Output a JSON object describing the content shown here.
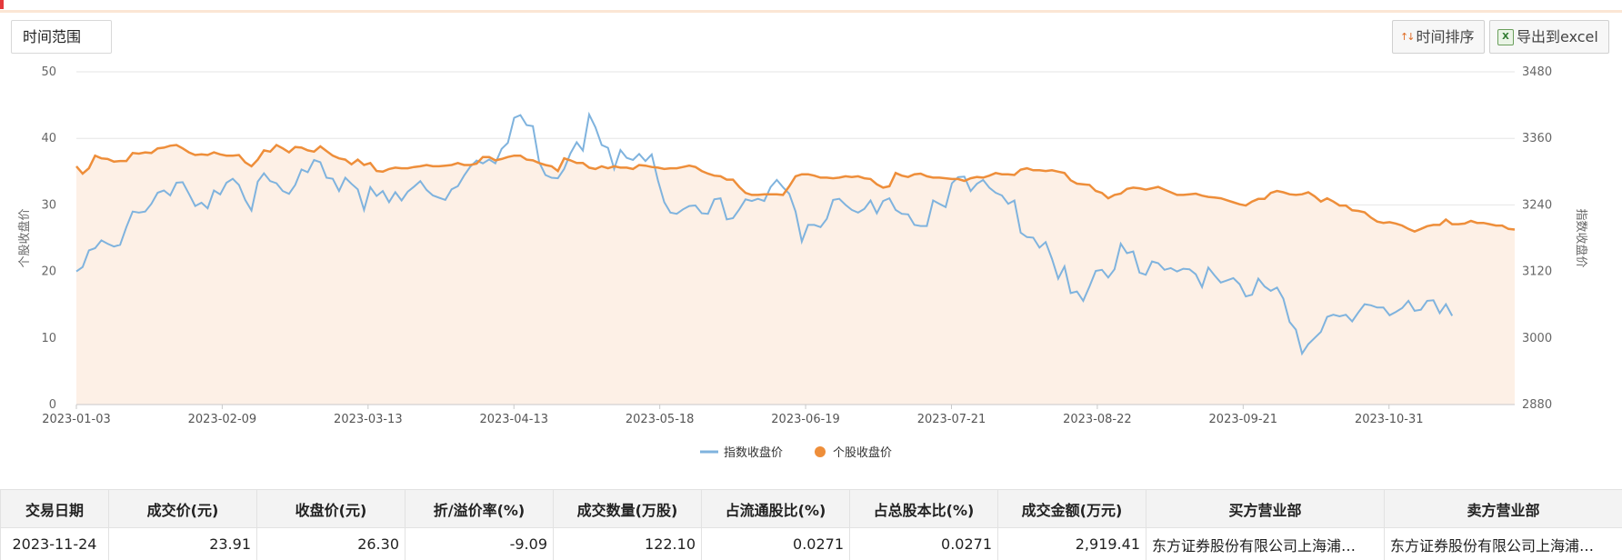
{
  "toolbar": {
    "time_range_label": "时间范围",
    "sort_label": "时间排序",
    "export_label": "导出到excel"
  },
  "colors": {
    "index_line": "#7fb3de",
    "stock_line": "#ee8e3a",
    "stock_area": "#fdf0e6",
    "accent": "#e4393c"
  },
  "chart_data": {
    "type": "line",
    "left_axis": {
      "label": "个股收盘价",
      "min": 0,
      "max": 50,
      "ticks": [
        "0",
        "10",
        "20",
        "30",
        "40",
        "50"
      ]
    },
    "right_axis": {
      "label": "指数收盘价",
      "min": 2880,
      "max": 3480,
      "ticks": [
        "2880",
        "3000",
        "3120",
        "3240",
        "3360",
        "3480"
      ]
    },
    "x_tick_labels": [
      "2023-01-03",
      "2023-02-09",
      "2023-03-13",
      "2023-04-13",
      "2023-05-18",
      "2023-06-19",
      "2023-07-21",
      "2023-08-22",
      "2023-09-21",
      "2023-10-31"
    ],
    "x_start": "2023-01-03",
    "x_end": "2023-11-24",
    "grid": true,
    "legend_position": "bottom",
    "series": [
      {
        "name": "指数收盘价",
        "axis": "right",
        "values": [
          3120,
          3128,
          3158,
          3162,
          3176,
          3170,
          3165,
          3168,
          3200,
          3228,
          3226,
          3228,
          3242,
          3262,
          3266,
          3257,
          3280,
          3281,
          3260,
          3238,
          3244,
          3234,
          3266,
          3259,
          3280,
          3287,
          3276,
          3249,
          3230,
          3282,
          3297,
          3283,
          3279,
          3265,
          3260,
          3276,
          3304,
          3299,
          3321,
          3317,
          3289,
          3287,
          3265,
          3289,
          3278,
          3268,
          3231,
          3272,
          3256,
          3265,
          3245,
          3263,
          3248,
          3264,
          3273,
          3283,
          3267,
          3257,
          3253,
          3249,
          3268,
          3274,
          3293,
          3309,
          3320,
          3315,
          3322,
          3315,
          3341,
          3352,
          3397,
          3402,
          3384,
          3382,
          3317,
          3294,
          3289,
          3288,
          3305,
          3333,
          3353,
          3338,
          3403,
          3380,
          3348,
          3343,
          3305,
          3339,
          3325,
          3321,
          3332,
          3319,
          3331,
          3284,
          3245,
          3226,
          3224,
          3232,
          3238,
          3239,
          3225,
          3224,
          3250,
          3252,
          3214,
          3216,
          3232,
          3250,
          3247,
          3251,
          3247,
          3272,
          3285,
          3272,
          3260,
          3228,
          3174,
          3204,
          3204,
          3200,
          3215,
          3249,
          3251,
          3240,
          3231,
          3226,
          3233,
          3248,
          3225,
          3247,
          3252,
          3231,
          3224,
          3223,
          3204,
          3202,
          3202,
          3248,
          3242,
          3236,
          3279,
          3290,
          3291,
          3265,
          3278,
          3285,
          3271,
          3262,
          3257,
          3242,
          3248,
          3190,
          3182,
          3181,
          3163,
          3173,
          3143,
          3107,
          3129,
          3081,
          3084,
          3067,
          3093,
          3121,
          3123,
          3109,
          3124,
          3170,
          3153,
          3156,
          3118,
          3114,
          3138,
          3135,
          3123,
          3126,
          3120,
          3125,
          3124,
          3115,
          3092,
          3127,
          3113,
          3100,
          3104,
          3108,
          3097,
          3075,
          3078,
          3107,
          3093,
          3085,
          3091,
          3071,
          3029,
          3015,
          2972,
          2989,
          3000,
          3011,
          3038,
          3042,
          3039,
          3042,
          3030,
          3046,
          3061,
          3059,
          3055,
          3055,
          3041,
          3047,
          3054,
          3067,
          3049,
          3051,
          3067,
          3068,
          3045,
          3061,
          3040
        ]
      },
      {
        "name": "个股收盘价",
        "axis": "left",
        "values": [
          35.8,
          34.7,
          35.5,
          37.4,
          37.0,
          36.9,
          36.5,
          36.6,
          36.6,
          37.8,
          37.7,
          37.9,
          37.8,
          38.5,
          38.6,
          38.9,
          39.0,
          38.5,
          37.9,
          37.5,
          37.6,
          37.5,
          37.9,
          37.6,
          37.4,
          37.4,
          37.5,
          36.4,
          35.8,
          36.8,
          38.2,
          38.0,
          39.0,
          38.5,
          37.9,
          38.7,
          38.6,
          38.2,
          38.0,
          38.8,
          38.1,
          37.4,
          37.0,
          36.8,
          36.1,
          36.8,
          36.0,
          36.3,
          35.1,
          35.0,
          35.4,
          35.6,
          35.5,
          35.5,
          35.7,
          35.8,
          36.0,
          35.8,
          35.8,
          35.9,
          36.0,
          36.3,
          36.0,
          36.0,
          36.2,
          37.2,
          37.2,
          36.7,
          36.9,
          37.2,
          37.4,
          37.4,
          36.8,
          36.7,
          36.3,
          36.0,
          35.8,
          35.1,
          37.0,
          36.7,
          36.3,
          36.3,
          35.6,
          35.4,
          35.8,
          35.5,
          35.8,
          35.6,
          35.6,
          35.4,
          36.0,
          35.9,
          35.7,
          35.6,
          35.4,
          35.5,
          35.5,
          35.7,
          35.9,
          35.7,
          35.1,
          34.7,
          34.4,
          34.3,
          33.8,
          33.8,
          32.7,
          31.8,
          31.5,
          31.5,
          31.6,
          31.6,
          31.6,
          31.5,
          32.8,
          34.3,
          34.6,
          34.6,
          34.4,
          34.1,
          34.1,
          34.0,
          34.1,
          34.3,
          34.2,
          34.3,
          34.0,
          33.9,
          33.1,
          32.6,
          32.8,
          34.8,
          34.4,
          34.2,
          34.6,
          34.7,
          34.3,
          34.1,
          34.1,
          34.0,
          33.9,
          33.9,
          33.6,
          34.0,
          34.2,
          34.1,
          34.4,
          34.8,
          34.6,
          34.6,
          34.5,
          35.3,
          35.5,
          35.2,
          35.2,
          35.1,
          35.2,
          35.0,
          34.8,
          33.7,
          33.2,
          33.1,
          33.0,
          32.1,
          31.8,
          31.0,
          31.5,
          31.7,
          32.4,
          32.6,
          32.5,
          32.3,
          32.5,
          32.7,
          32.3,
          31.9,
          31.5,
          31.5,
          31.6,
          31.7,
          31.4,
          31.2,
          31.1,
          31.0,
          30.7,
          30.4,
          30.1,
          29.9,
          30.5,
          30.9,
          30.9,
          31.8,
          32.1,
          31.9,
          31.6,
          31.5,
          31.6,
          31.9,
          31.3,
          30.5,
          31.0,
          30.5,
          29.9,
          29.9,
          29.2,
          29.1,
          28.9,
          28.1,
          27.5,
          27.3,
          27.4,
          27.2,
          26.9,
          26.4,
          26.0,
          26.4,
          26.8,
          27.0,
          27.0,
          27.8,
          27.1,
          27.1,
          27.2,
          27.6,
          27.3,
          27.3,
          27.1,
          26.9,
          26.9,
          26.4,
          26.3
        ]
      }
    ]
  },
  "table": {
    "headers": [
      "交易日期",
      "成交价(元)",
      "收盘价(元)",
      "折/溢价率(%)",
      "成交数量(万股)",
      "占流通股比(%)",
      "占总股本比(%)",
      "成交金额(万元)",
      "买方营业部",
      "卖方营业部"
    ],
    "rows": [
      [
        "2023-11-24",
        "23.91",
        "26.30",
        "-9.09",
        "122.10",
        "0.0271",
        "0.0271",
        "2,919.41",
        "东方证券股份有限公司上海浦…",
        "东方证券股份有限公司上海浦…"
      ]
    ]
  }
}
